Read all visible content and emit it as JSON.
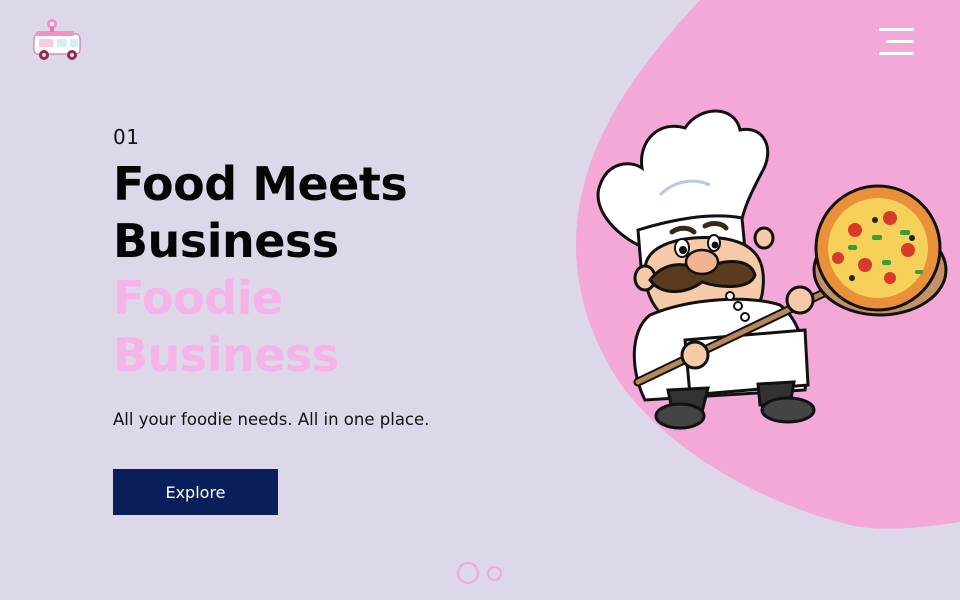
{
  "header": {
    "logo_icon": "food-truck-icon",
    "menu_icon": "hamburger-menu-icon"
  },
  "hero": {
    "slide_number": "01",
    "headline_line1": "Food Meets",
    "headline_line2": "Business",
    "headline_line3": "Foodie",
    "headline_line4": "Business",
    "tagline": "All your foodie needs. All in one place.",
    "cta_label": "Explore",
    "illustration_icon": "chef-with-pizza-icon"
  },
  "carousel": {
    "dot_count": 2,
    "active_index": 1
  },
  "colors": {
    "background": "#dcd8ea",
    "blob_pink": "#f3a8d8",
    "accent_pink": "#f5b3e8",
    "button_navy": "#0a1f5a",
    "text_dark": "#050505"
  }
}
